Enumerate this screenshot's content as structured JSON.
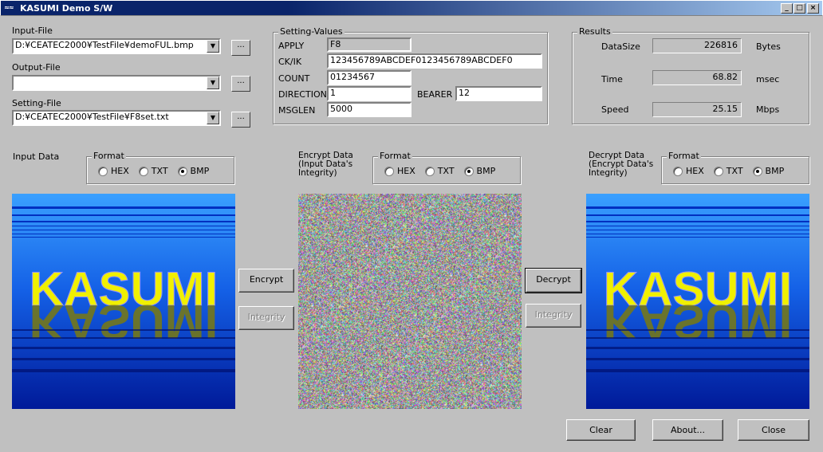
{
  "window": {
    "title": "KASUMI Demo S/W",
    "icon": "kasumi-app-icon"
  },
  "files": {
    "input_label": "Input-File",
    "input_value": "D:¥CEATEC2000¥TestFile¥demoFUL.bmp",
    "output_label": "Output-File",
    "output_value": "",
    "setting_label": "Setting-File",
    "setting_value": "D:¥CEATEC2000¥TestFile¥F8set.txt",
    "browse_label": "..."
  },
  "settings": {
    "group_label": "Setting-Values",
    "apply_label": "APPLY",
    "apply_value": "F8",
    "ckik_label": "CK/IK",
    "ckik_value": "123456789ABCDEF0123456789ABCDEF0",
    "count_label": "COUNT",
    "count_value": "01234567",
    "direction_label": "DIRECTION",
    "direction_value": "1",
    "bearer_label": "BEARER",
    "bearer_value": "12",
    "msglen_label": "MSGLEN",
    "msglen_value": "5000"
  },
  "results": {
    "group_label": "Results",
    "datasize_label": "DataSize",
    "datasize_value": "226816",
    "datasize_unit": "Bytes",
    "time_label": "Time",
    "time_value": "68.82",
    "time_unit": "msec",
    "speed_label": "Speed",
    "speed_value": "25.15",
    "speed_unit": "Mbps"
  },
  "panels": {
    "input_title": "Input Data",
    "encrypt_title_1": "Encrypt Data",
    "encrypt_title_2": "(Input Data's",
    "encrypt_title_3": "Integrity)",
    "decrypt_title_1": "Decrypt Data",
    "decrypt_title_2": "(Encrypt Data's",
    "decrypt_title_3": "Integrity)",
    "format_label": "Format",
    "format_hex": "HEX",
    "format_txt": "TXT",
    "format_bmp": "BMP",
    "selected_format": "BMP",
    "image_text": "KASUMI"
  },
  "buttons": {
    "encrypt": "Encrypt",
    "integrity": "Integrity",
    "decrypt": "Decrypt",
    "clear": "Clear",
    "about": "About...",
    "close": "Close"
  },
  "colors": {
    "title_bar": "#0a246a",
    "image_blue": "#0033cc",
    "image_text_yellow": "#f0f000"
  }
}
